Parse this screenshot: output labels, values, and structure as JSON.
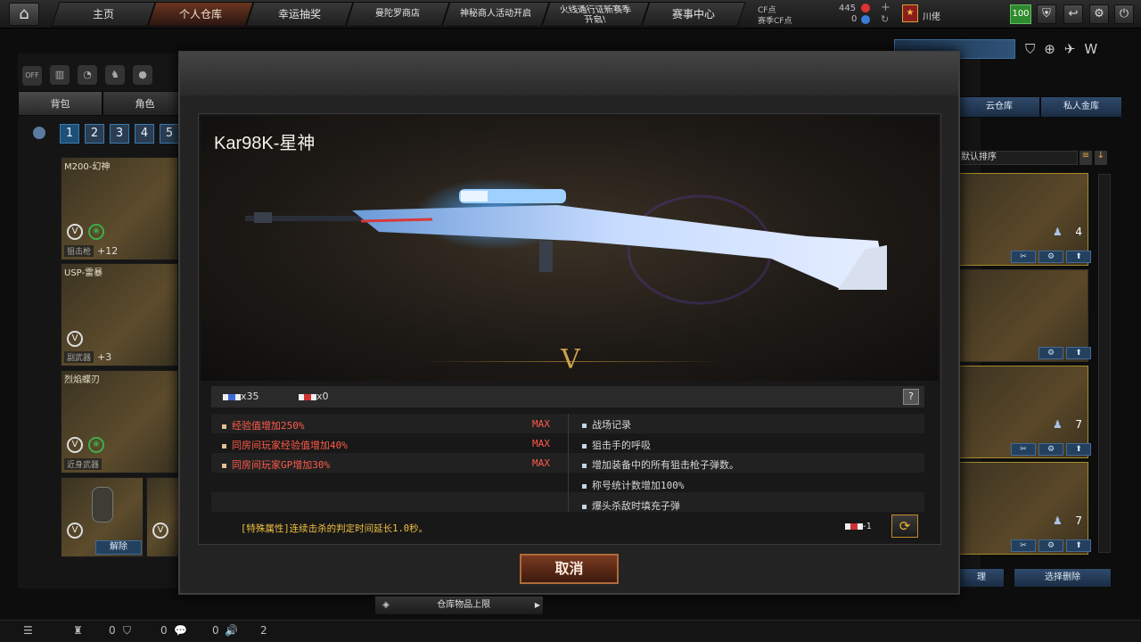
{
  "topbar": {
    "nav": [
      {
        "label": "主页"
      },
      {
        "label": "个人仓库"
      },
      {
        "label": "幸运抽奖"
      },
      {
        "label": "曼陀罗商店"
      },
      {
        "label": "神秘商人活动开启"
      },
      {
        "label_line1": "火线通行证新赛季",
        "label_line2": "开启!"
      },
      {
        "label": "赛事中心"
      }
    ],
    "cf_label": "CF点",
    "cf_value": "445",
    "season_cf_label": "赛季CF点",
    "season_cf_value": "0",
    "user_name": "川佬",
    "level": "100"
  },
  "left_panel": {
    "tabs": [
      "背包",
      "角色"
    ],
    "pages": [
      "1",
      "2",
      "3",
      "4",
      "5"
    ],
    "items": [
      {
        "name": "M200-幻神",
        "category": "狙击枪",
        "plus": "+12"
      },
      {
        "name": "USP-雷暴",
        "category": "副武器",
        "plus": "+3"
      },
      {
        "name": "烈焰蝶刃",
        "category": "近身武器",
        "plus": ""
      }
    ],
    "remove_label": "解除",
    "icon_off_label": "OFF"
  },
  "right_panel": {
    "tabs": [
      "云仓库",
      "私人金库"
    ],
    "sort_label": "默认排序",
    "counts": [
      "4",
      "",
      "7",
      "7"
    ],
    "bottom_left_label": "理",
    "bottom_right_label": "选择删除"
  },
  "modal": {
    "weapon_name": "Kar98K-星神",
    "stat_a": "x35",
    "stat_b": "x0",
    "help": "?",
    "left_attrs": [
      {
        "text": "经验值增加250%",
        "max": "MAX"
      },
      {
        "text": "同房间玩家经验值增加40%",
        "max": "MAX"
      },
      {
        "text": "同房间玩家GP增加30%",
        "max": "MAX"
      }
    ],
    "right_attrs": [
      "战场记录",
      "狙击手的呼吸",
      "增加装备中的所有狙击枪子弹数。",
      "称号统计数增加100%",
      "爆头杀敌时填充子弹"
    ],
    "special": "[特殊属性]连续击杀的判定时间延长1.0秒。",
    "cost": "-1",
    "cancel_label": "取消"
  },
  "bottom": {
    "storage_label": "仓库物品上限",
    "c1": "0",
    "c2": "0",
    "c3": "0",
    "c4": "2"
  }
}
